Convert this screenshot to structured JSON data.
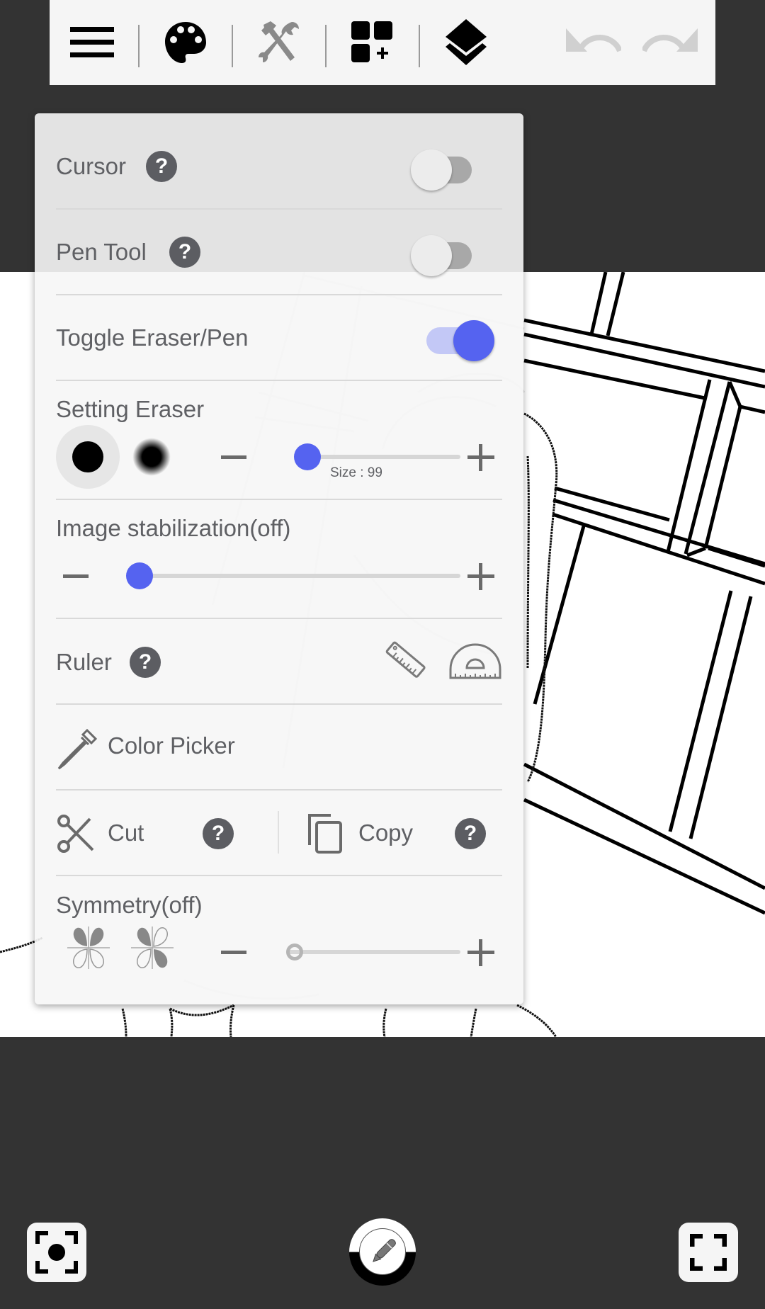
{
  "toolbar": {
    "items": [
      {
        "name": "menu",
        "icon": "hamburger-menu-icon"
      },
      {
        "name": "palette",
        "icon": "palette-icon"
      },
      {
        "name": "tools",
        "icon": "hammer-wrench-icon",
        "active": true
      },
      {
        "name": "add-widget",
        "icon": "add-widget-icon"
      },
      {
        "name": "layers",
        "icon": "layers-icon"
      },
      {
        "name": "undo",
        "icon": "undo-icon",
        "enabled": false
      },
      {
        "name": "redo",
        "icon": "redo-icon",
        "enabled": false
      }
    ]
  },
  "panel": {
    "cursor": {
      "label": "Cursor",
      "help": "?",
      "on": false
    },
    "pen_tool": {
      "label": "Pen Tool",
      "help": "?",
      "on": false
    },
    "toggle_eraser_pen": {
      "label": "Toggle Eraser/Pen",
      "on": true
    },
    "setting_eraser": {
      "label": "Setting Eraser",
      "brushes": [
        "hard-brush",
        "soft-brush"
      ],
      "selected_brush": "hard-brush",
      "size_label": "Size : 99",
      "size_value": 99,
      "slider_fraction": 0.0
    },
    "image_stabilization": {
      "label": "Image stabilization(off)",
      "slider_fraction": 0.0
    },
    "ruler": {
      "label": "Ruler",
      "help": "?",
      "tools": [
        "straight-ruler-icon",
        "protractor-icon"
      ]
    },
    "color_picker": {
      "label": "Color Picker"
    },
    "cut": {
      "label": "Cut",
      "help": "?"
    },
    "copy": {
      "label": "Copy",
      "help": "?"
    },
    "symmetry": {
      "label": "Symmetry(off)",
      "modes": [
        "mirror-symmetry-icon",
        "rotational-symmetry-icon"
      ],
      "slider_fraction": 0.0
    }
  },
  "bottom_bar": {
    "left": "screenshot-focus-icon",
    "center": "pen-mode-icon",
    "right": "fullscreen-icon"
  },
  "colors": {
    "accent": "#5563f0",
    "background": "#333333",
    "toolbar": "#f5f5f5",
    "text": "#5f6064"
  }
}
